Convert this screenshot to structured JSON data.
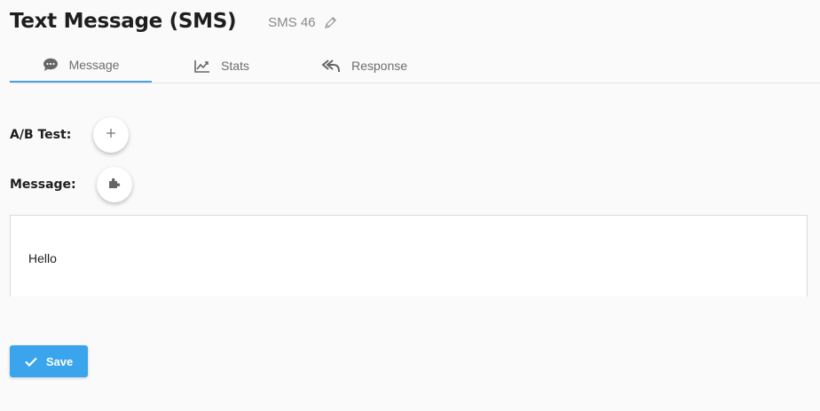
{
  "header": {
    "title": "Text Message (SMS)",
    "subtitle": "SMS 46",
    "edit_icon": "pencil-icon"
  },
  "tabs": [
    {
      "label": "Message",
      "icon": "chat-bubble-icon",
      "active": true
    },
    {
      "label": "Stats",
      "icon": "line-chart-icon",
      "active": false
    },
    {
      "label": "Response",
      "icon": "reply-all-icon",
      "active": false
    }
  ],
  "form": {
    "ab_test_label": "A/B Test:",
    "ab_test_icon": "plus-icon",
    "message_label": "Message:",
    "message_icon": "puzzle-icon",
    "message_value": "Hello"
  },
  "actions": {
    "save_label": "Save",
    "save_icon": "check-icon"
  },
  "colors": {
    "accent": "#3aa5ec",
    "tab_underline": "#4aa3e0"
  }
}
